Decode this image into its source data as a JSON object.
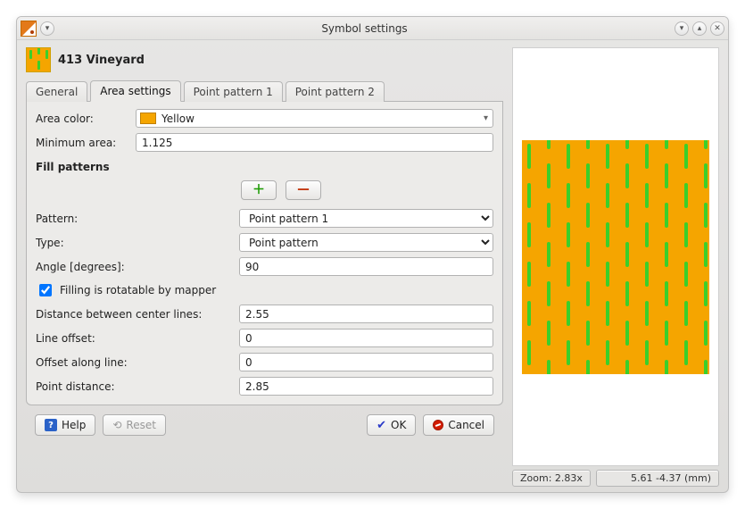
{
  "window": {
    "title": "Symbol settings"
  },
  "symbol": {
    "title": "413 Vineyard"
  },
  "tabs": [
    {
      "label": "General"
    },
    {
      "label": "Area settings"
    },
    {
      "label": "Point pattern 1"
    },
    {
      "label": "Point pattern 2"
    }
  ],
  "area": {
    "area_color_label": "Area color:",
    "color_name": "Yellow",
    "min_area_label": "Minimum area:",
    "min_area_value": "1.125"
  },
  "fill": {
    "section_title": "Fill patterns",
    "pattern_label": "Pattern:",
    "pattern_value": "Point pattern 1",
    "type_label": "Type:",
    "type_value": "Point pattern",
    "angle_label": "Angle [degrees]:",
    "angle_value": "90",
    "rotatable_label": "Filling is rotatable by mapper",
    "rotatable_checked": true,
    "dist_label": "Distance between center lines:",
    "dist_value": "2.55",
    "line_offset_label": "Line offset:",
    "line_offset_value": "0",
    "offset_along_label": "Offset along line:",
    "offset_along_value": "0",
    "point_dist_label": "Point distance:",
    "point_dist_value": "2.85"
  },
  "buttons": {
    "help": "Help",
    "reset": "Reset",
    "ok": "OK",
    "cancel": "Cancel"
  },
  "status": {
    "zoom": "Zoom: 2.83x",
    "coords": "5.61 -4.37 (mm)"
  },
  "colors": {
    "fill": "#f5a500",
    "dash": "#3bcf2a"
  }
}
